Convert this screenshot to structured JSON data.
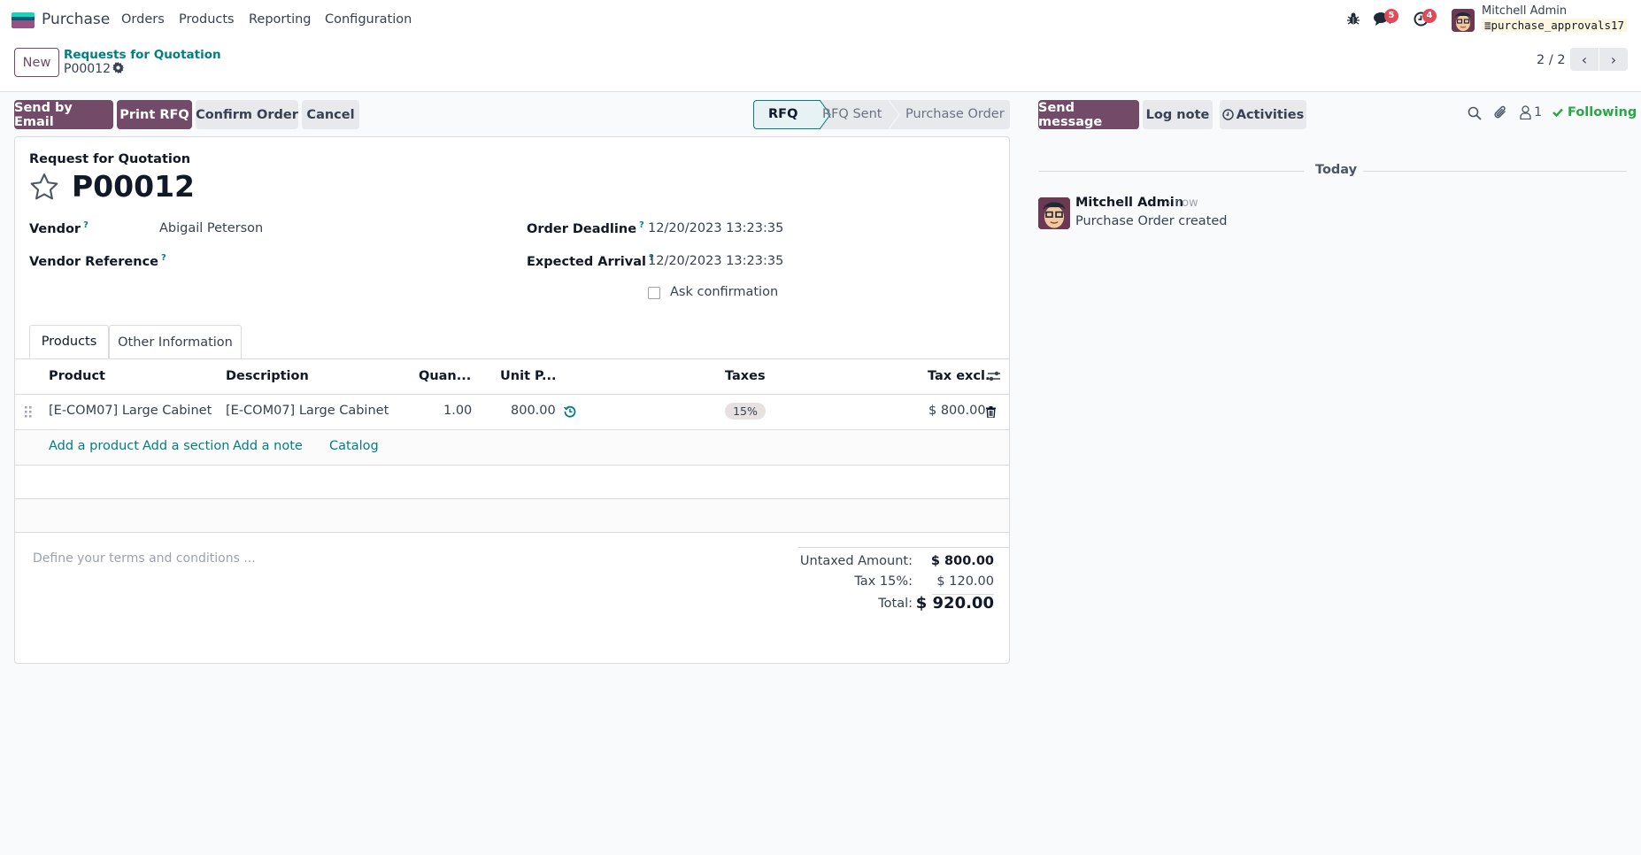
{
  "topnav": {
    "app_name": "Purchase",
    "menu": [
      "Orders",
      "Products",
      "Reporting",
      "Configuration"
    ],
    "messages_badge": "5",
    "activities_badge": "4",
    "user_name": "Mitchell Admin",
    "db_name": "purchase_approvals17"
  },
  "controlpanel": {
    "new_label": "New",
    "breadcrumb_parent": "Requests for Quotation",
    "breadcrumb_current": "P00012",
    "pager": "2 / 2"
  },
  "actions": {
    "send_by_email": "Send by Email",
    "print_rfq": "Print RFQ",
    "confirm_order": "Confirm Order",
    "cancel": "Cancel"
  },
  "statusbar": {
    "stages": [
      "RFQ",
      "RFQ Sent",
      "Purchase Order"
    ],
    "active": "RFQ"
  },
  "form": {
    "subtitle": "Request for Quotation",
    "name": "P00012",
    "fields": {
      "vendor_label": "Vendor",
      "vendor_value": "Abigail Peterson",
      "vendor_ref_label": "Vendor Reference",
      "vendor_ref_value": "",
      "order_deadline_label": "Order Deadline",
      "order_deadline_value": "12/20/2023 13:23:35",
      "expected_arrival_label": "Expected Arrival",
      "expected_arrival_value": "12/20/2023 13:23:35",
      "ask_confirmation_label": "Ask confirmation",
      "ask_confirmation_checked": false,
      "help_mark": "?"
    },
    "tabs": [
      "Products",
      "Other Information"
    ],
    "active_tab": "Products",
    "table": {
      "headers": [
        "Product",
        "Description",
        "Quan...",
        "Unit P...",
        "Taxes",
        "Tax excl."
      ],
      "rows": [
        {
          "product": "[E-COM07] Large Cabinet",
          "description": "[E-COM07] Large Cabinet",
          "quantity": "1.00",
          "unit_price": "800.00",
          "taxes": "15%",
          "subtotal": "$ 800.00"
        }
      ],
      "add_links": [
        "Add a product",
        "Add a section",
        "Add a note",
        "Catalog"
      ]
    },
    "terms_placeholder": "Define your terms and conditions ...",
    "totals": {
      "untaxed_label": "Untaxed Amount:",
      "untaxed_value": "$ 800.00",
      "tax_label": "Tax 15%:",
      "tax_value": "$ 120.00",
      "total_label": "Total:",
      "total_value": "$ 920.00"
    }
  },
  "chatter": {
    "send_message": "Send message",
    "log_note": "Log note",
    "activities": "Activities",
    "followers_count": "1",
    "following": "Following",
    "date_separator": "Today",
    "messages": [
      {
        "author": "Mitchell Admin",
        "date": "- now",
        "body": "Purchase Order created"
      }
    ]
  },
  "colors": {
    "primary": "#714b67",
    "link": "#017e84",
    "following": "#28a745",
    "badge": "#e04b59"
  }
}
